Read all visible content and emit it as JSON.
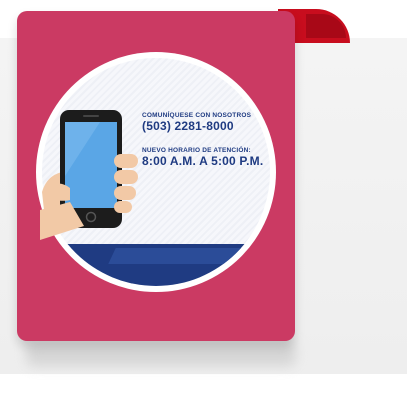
{
  "contact": {
    "heading": "COMUNÍQUESE CON NOSOTROS",
    "phone": "(503) 2281-8000",
    "hours_heading": "NUEVO HORARIO DE ATENCIÓN:",
    "hours": "8:00 A.M. A 5:00 P.M."
  },
  "icons": {
    "phone": "smartphone-in-hand-icon",
    "ribbon": "ribbon-curl"
  },
  "colors": {
    "card": "#cb3a63",
    "ribbon": "#c80d1e",
    "text": "#1f3b82",
    "sleeve": "#1f3b82",
    "phone_screen": "#5aa6e6"
  }
}
